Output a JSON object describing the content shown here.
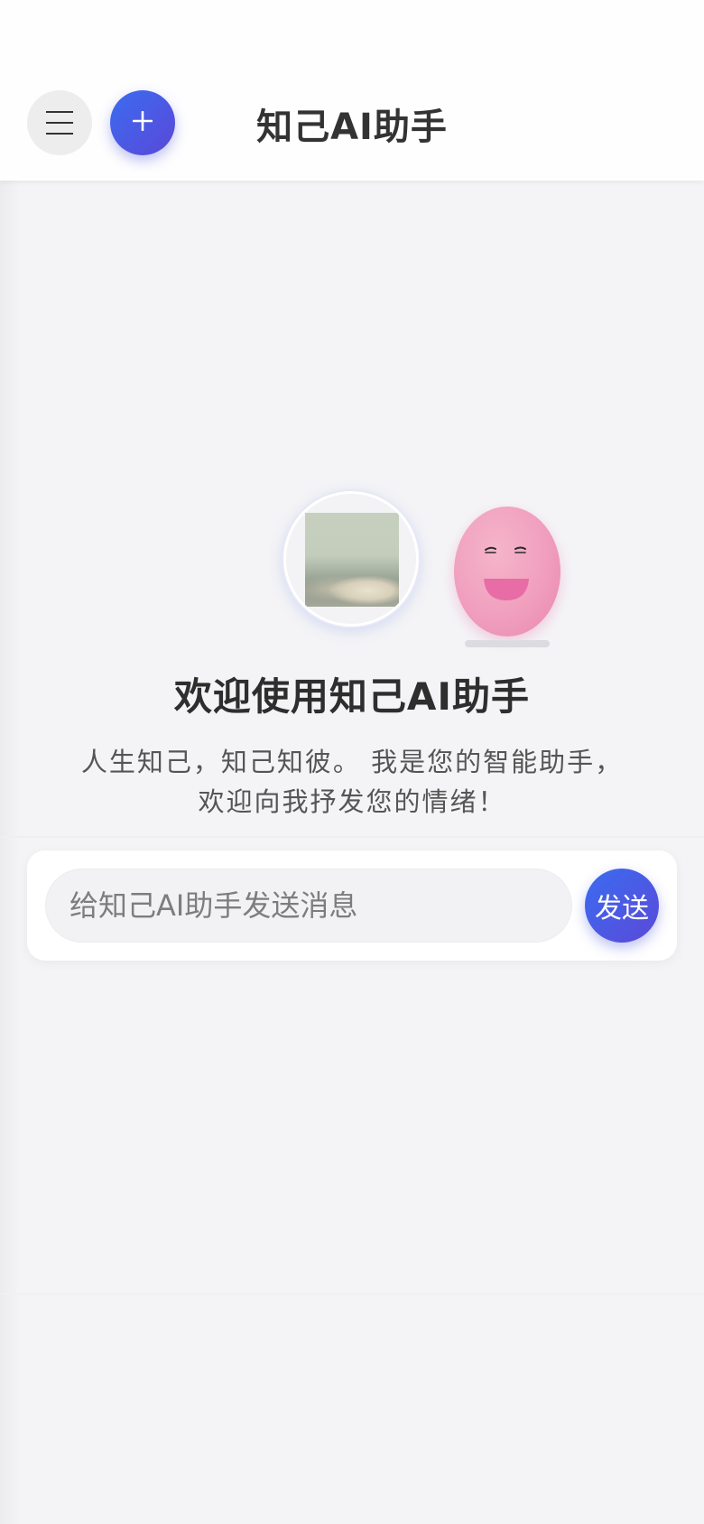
{
  "header": {
    "title": "知己AI助手",
    "menu_icon": "hamburger-menu-icon",
    "new_chat_icon": "plus-icon",
    "new_chat_label": "+"
  },
  "welcome": {
    "title": "欢迎使用知己AI助手",
    "subtitle_line1": "人生知己，知己知彼。 我是您的智能助手，",
    "subtitle_line2": "欢迎向我抒发您的情绪！"
  },
  "avatars": {
    "user_avatar": "user-avatar-clouds-photo",
    "mascot": "pink-smiling-egg-mascot"
  },
  "composer": {
    "placeholder": "给知己AI助手发送消息",
    "value": "",
    "send_label": "发送"
  },
  "colors": {
    "accent_start": "#3b6cf0",
    "accent_end": "#5a48d8",
    "mascot_pink": "#f09fbd",
    "background": "#f4f4f6"
  }
}
